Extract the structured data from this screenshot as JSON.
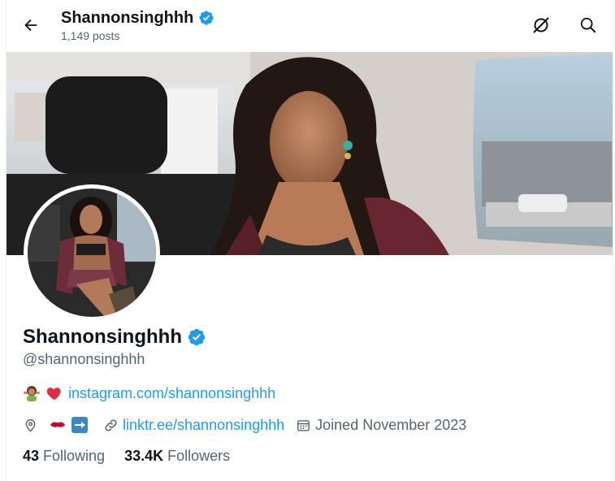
{
  "header": {
    "title": "Shannonsinghhh",
    "post_count": "1,149 posts",
    "icons": {
      "back": "arrow-left-icon",
      "grok": "slashed-circle-icon",
      "search": "search-icon"
    }
  },
  "profile": {
    "display_name": "Shannonsinghhh",
    "handle": "@shannonsinghhh",
    "verified": true,
    "bio_emojis": [
      "woman-gesturing-emoji",
      "red-heart-emoji"
    ],
    "bio_link": "instagram.com/shannonsinghhh",
    "location_emojis": [
      "kiss-mark-emoji",
      "right-arrow-emoji"
    ],
    "website": "linktr.ee/shannonsinghhh",
    "joined": "Joined November 2023",
    "following_count": "43",
    "following_label": "Following",
    "followers_count": "33.4K",
    "followers_label": "Followers"
  },
  "colors": {
    "accent": "#1d9bf0",
    "text": "#0f1419",
    "secondary": "#536471",
    "verified": "#1d9bf0"
  }
}
